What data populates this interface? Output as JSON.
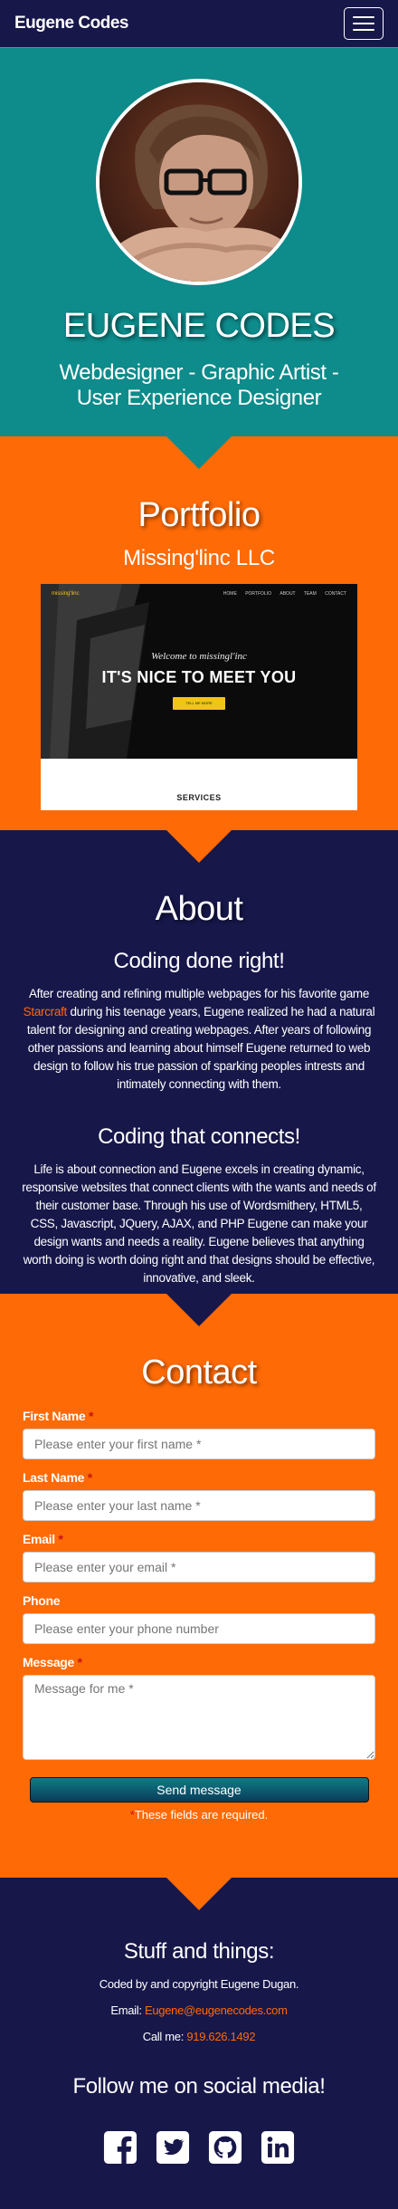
{
  "nav": {
    "brand": "Eugene Codes"
  },
  "header": {
    "name": "EUGENE CODES",
    "tagline": "Webdesigner - Graphic Artist - User Experience Designer"
  },
  "portfolio": {
    "title": "Portfolio",
    "client": "Missing'linc LLC",
    "screenshot": {
      "logo": "missing'linc",
      "nav_links": [
        "HOME",
        "PORTFOLIO",
        "ABOUT",
        "TEAM",
        "CONTACT"
      ],
      "welcome": "Welcome to missingl'inc",
      "headline": "IT'S NICE TO MEET YOU",
      "button": "TELL ME MORE",
      "services": "SERVICES"
    }
  },
  "about": {
    "title": "About",
    "h1": "Coding done right!",
    "p1_before": "After creating and refining multiple webpages for his favorite game ",
    "p1_link": "Starcraft",
    "p1_after": " during his teenage years, Eugene realized he had a natural talent for designing and creating webpages. After years of following other passions and learning about himself Eugene returned to web design to follow his true passion of sparking peoples intrests and intimately connecting with them.",
    "h2": "Coding that connects!",
    "p2": "Life is about connection and Eugene excels in creating dynamic, responsive websites that connect clients with the wants and needs of their customer base. Through his use of Wordsmithery, HTML5, CSS, Javascript, JQuery, AJAX, and PHP Eugene can make your design wants and needs a reality. Eugene believes that anything worth doing is worth doing right and that designs should be effective, innovative, and sleek."
  },
  "contact": {
    "title": "Contact",
    "fields": {
      "first": {
        "label": "First Name",
        "placeholder": "Please enter your first name *"
      },
      "last": {
        "label": "Last Name",
        "placeholder": "Please enter your last name *"
      },
      "email": {
        "label": "Email",
        "placeholder": "Please enter your email *"
      },
      "phone": {
        "label": "Phone",
        "placeholder": "Please enter your phone number"
      },
      "message": {
        "label": "Message",
        "placeholder": "Message for me *"
      }
    },
    "required_mark": "*",
    "send": "Send message",
    "required_note": "These fields are required."
  },
  "footer": {
    "title": "Stuff and things:",
    "copyright": "Coded by and copyright Eugene Dugan.",
    "email_label": "Email: ",
    "email": "Eugene@eugenecodes.com",
    "phone_label": "Call me: ",
    "phone": "919.626.1492",
    "follow": "Follow me on social media!",
    "socials": [
      "facebook-icon",
      "twitter-icon",
      "github-icon",
      "linkedin-icon"
    ]
  },
  "colors": {
    "navy": "#17174a",
    "teal": "#0e8b8b",
    "orange": "#fe6a06",
    "required": "#c81414"
  }
}
